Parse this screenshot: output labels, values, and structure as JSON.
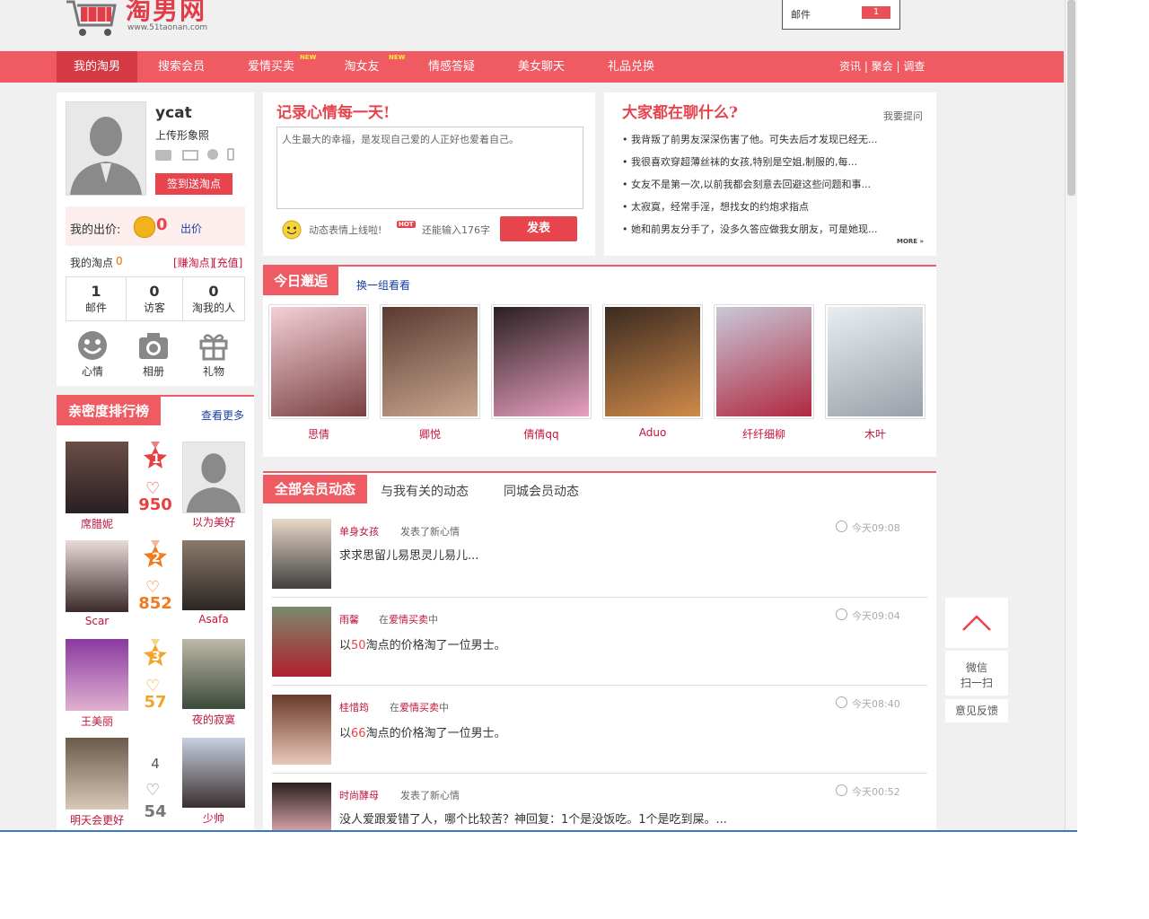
{
  "header": {
    "logo_text": "淘男网",
    "logo_sub": "www.51taonan.com",
    "mail_label": "邮件",
    "mail_count": "1"
  },
  "nav": {
    "items": [
      {
        "label": "我的淘男"
      },
      {
        "label": "搜索会员"
      },
      {
        "label": "爱情买卖",
        "badge": "NEW"
      },
      {
        "label": "淘女友",
        "badge": "NEW"
      },
      {
        "label": "情感答疑"
      },
      {
        "label": "美女聊天"
      },
      {
        "label": "礼品兑换"
      }
    ],
    "right": [
      "资讯",
      "聚会",
      "调查"
    ]
  },
  "profile": {
    "username": "ycat",
    "upload_link": "上传形象照",
    "sign_button": "签到送淘点",
    "bid_label": "我的出价:",
    "bid_value": "0",
    "bid_action": "出价",
    "points_label": "我的淘点",
    "points_value": "0",
    "earn_link": "[赚淘点]",
    "recharge_link": "[充值]",
    "stats": [
      {
        "num": "1",
        "label": "邮件"
      },
      {
        "num": "0",
        "label": "访客"
      },
      {
        "num": "0",
        "label": "淘我的人"
      }
    ],
    "actions": [
      {
        "label": "心情",
        "icon": "smile-icon"
      },
      {
        "label": "相册",
        "icon": "camera-icon"
      },
      {
        "label": "礼物",
        "icon": "gift-icon"
      }
    ]
  },
  "ranking": {
    "title": "亲密度排行榜",
    "more": "查看更多",
    "rows": [
      {
        "left": "席腊妮",
        "rank": "1",
        "score": "950",
        "right": "以为美好"
      },
      {
        "left": "Scar",
        "rank": "2",
        "score": "852",
        "right": "Asafa"
      },
      {
        "left": "王美丽",
        "rank": "3",
        "score": "57",
        "right": "夜的寂寞"
      },
      {
        "left": "明天会更好",
        "rank": "4",
        "score": "54",
        "right": "少帅"
      }
    ]
  },
  "mood": {
    "title": "记录心情每一天!",
    "text": "人生最大的幸福，是发现自己爱的人正好也爱着自己。",
    "emoji_tip": "动态表情上线啦!",
    "hot": "HOT",
    "remaining": "还能输入176字",
    "submit": "发表"
  },
  "chat": {
    "title": "大家都在聊什么?",
    "ask": "我要提问",
    "more": "MORE",
    "items": [
      "我背叛了前男友深深伤害了他。可失去后才发现已经无...",
      "我很喜欢穿超薄丝袜的女孩,特别是空姐,制服的,每...",
      "女友不是第一次,以前我都会刻意去回避这些问题和事...",
      "太寂寞，经常手淫，想找女的约炮求指点",
      "她和前男友分手了，没多久答应做我女朋友，可是她现..."
    ]
  },
  "meet": {
    "title": "今日邂逅",
    "refresh": "换一组看看",
    "people": [
      "思倩",
      "卿悦",
      "倩倩qq",
      "Aduo",
      "纤纤细柳",
      "木叶"
    ]
  },
  "feed": {
    "tabs": [
      "全部会员动态",
      "与我有关的动态",
      "同城会员动态"
    ],
    "items": [
      {
        "name": "单身女孩",
        "action": "发表了新心情",
        "time": "今天09:08",
        "content": "求求思留儿易思灵儿易儿..."
      },
      {
        "name": "雨馨",
        "pre": "在",
        "link": "爱情买卖",
        "post": "中",
        "time": "今天09:04",
        "c1": "以",
        "num": "50",
        "c2": "淘点的价格淘了一位男士。"
      },
      {
        "name": "桂惜筠",
        "pre": "在",
        "link": "爱情买卖",
        "post": "中",
        "time": "今天08:40",
        "c1": "以",
        "num": "66",
        "c2": "淘点的价格淘了一位男士。"
      },
      {
        "name": "时尚酵母",
        "action": "发表了新心情",
        "time": "今天00:52",
        "content": "没人爱跟爱错了人，哪个比较苦？神回复：1个是没饭吃。1个是吃到屎。..."
      }
    ]
  },
  "side": {
    "top_icon": "chevron-up-icon",
    "wechat": "微信",
    "scan": "扫一扫",
    "feedback": "意见反馈"
  },
  "colors": {
    "brand": "#f05a62",
    "link": "#c0143c",
    "accent": "#e8444d"
  }
}
